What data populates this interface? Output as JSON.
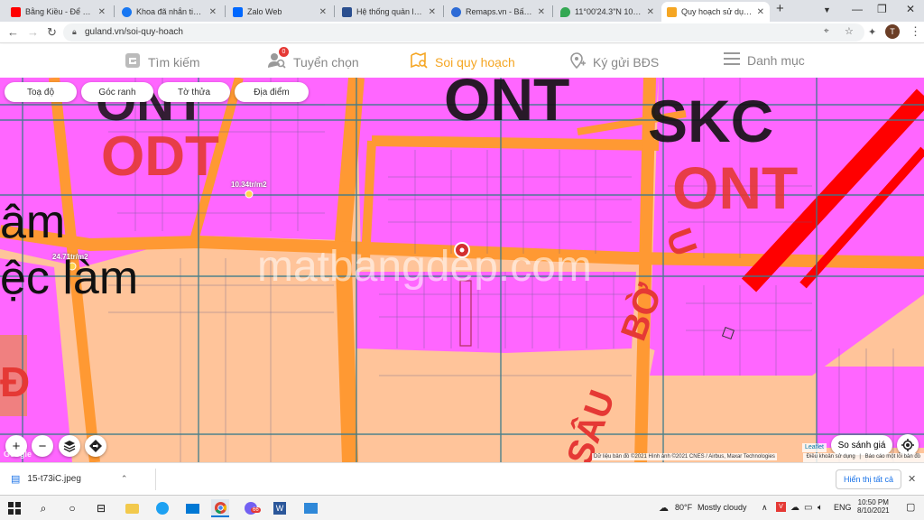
{
  "browser": {
    "tabs": [
      {
        "title": "Bằng Kiều - Để Nhớ Một",
        "favicon_color": "#ff0000"
      },
      {
        "title": "Khoa đã nhắn tin cho bạn",
        "favicon_color": "#1877f2"
      },
      {
        "title": "Zalo Web",
        "favicon_color": "#0068ff"
      },
      {
        "title": "Hệ thống quản lý BĐS",
        "favicon_color": "#2b4f8f"
      },
      {
        "title": "Remaps.vn - Bất động sản",
        "favicon_color": "#2d6bd6"
      },
      {
        "title": "11°00'24.3\"N 106°31'",
        "favicon_color": "#34a853"
      },
      {
        "title": "Quy hoạch sử dụng đất",
        "favicon_color": "#f5a623"
      }
    ],
    "new_tab_icon": "+",
    "url": "guland.vn/soi-quy-hoach",
    "profile_initial": "T"
  },
  "site_nav": {
    "items": [
      {
        "label": "Tìm kiếm",
        "icon": "search-logo-icon"
      },
      {
        "label": "Tuyển chọn",
        "icon": "user-search-icon",
        "badge": "0"
      },
      {
        "label": "Soi quy hoạch",
        "icon": "map-search-icon",
        "active": true
      },
      {
        "label": "Ký gửi BĐS",
        "icon": "pin-plus-icon"
      },
      {
        "label": "Danh mục",
        "icon": "menu-icon"
      }
    ],
    "active_color": "#f5a623"
  },
  "map": {
    "filter_pills": [
      "Toạ độ",
      "Góc ranh",
      "Tờ thửa",
      "Địa điểm"
    ],
    "zone_labels": [
      "ONT",
      "ODT",
      "ONT",
      "SKC",
      "ONT"
    ],
    "street_text": [
      "âm",
      "ệc làm",
      "BỜ",
      "U",
      "SÂU",
      "Đ"
    ],
    "price_labels": [
      "10.34tr/m2",
      "24.71tr/m2"
    ],
    "watermark": "matbangdep.com",
    "compare_button": "So sánh giá",
    "leaflet_label": "Leaflet",
    "copyright": "Dữ liệu bản đồ ©2021 Hình ảnh ©2021 CNES / Airbus, Maxar Technologies",
    "terms": "Điều khoản sử dụng",
    "report": "Báo cáo một lỗi bản đồ",
    "google_label": "Google",
    "colors": {
      "residential_pink": "#ff66ff",
      "agricultural_peach": "#ffc49a",
      "road_orange": "#ff9933",
      "skc_red": "#ff0000"
    }
  },
  "downloads": {
    "file_name": "15-t73iC.jpeg",
    "show_all": "Hiển thị tất cả"
  },
  "taskbar": {
    "weather_temp": "80°F",
    "weather_desc": "Mostly cloudy",
    "language": "ENG",
    "time": "10:50 PM",
    "date": "8/10/2021",
    "viber_badge": "66"
  }
}
